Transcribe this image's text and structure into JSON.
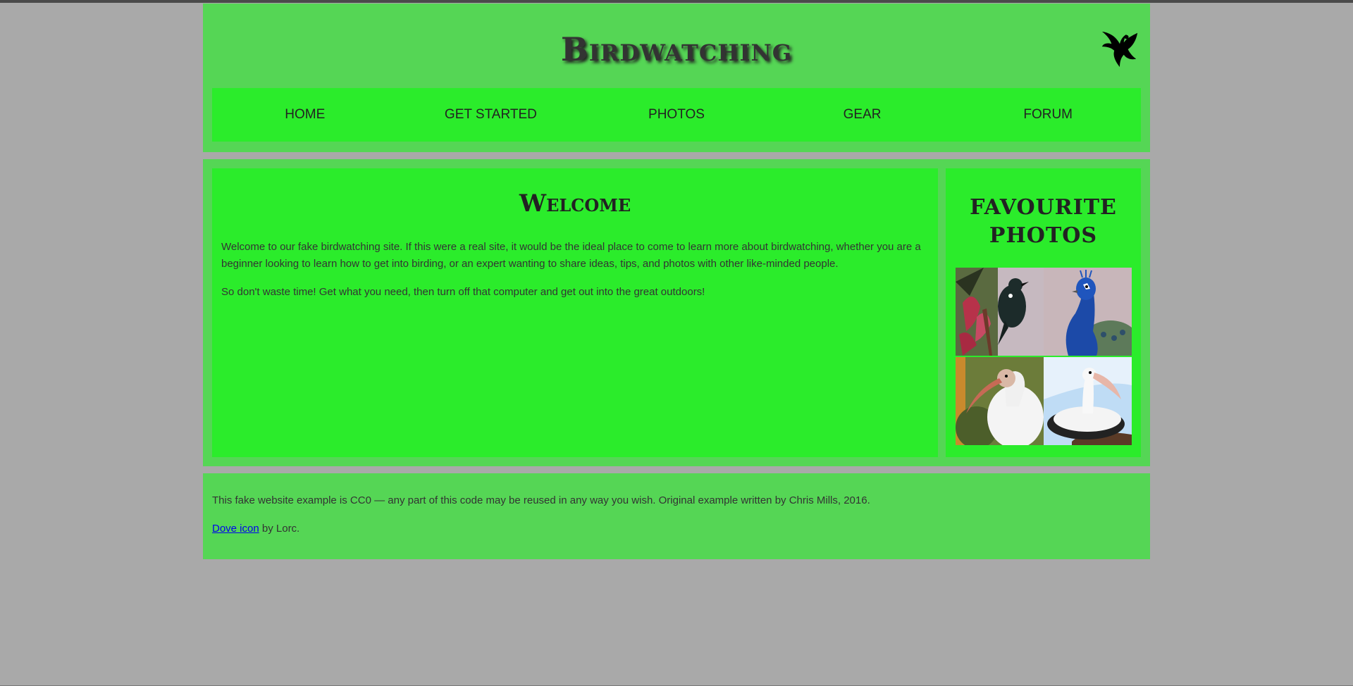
{
  "header": {
    "title": "Birdwatching",
    "logo_icon": "dove-icon"
  },
  "nav": {
    "items": [
      {
        "label": "HOME"
      },
      {
        "label": "GET STARTED"
      },
      {
        "label": "PHOTOS"
      },
      {
        "label": "GEAR"
      },
      {
        "label": "FORUM"
      }
    ]
  },
  "article": {
    "heading": "Welcome",
    "paragraphs": [
      "Welcome to our fake birdwatching site. If this were a real site, it would be the ideal place to come to learn more about birdwatching, whether you are a beginner looking to learn how to get into birding, or an expert wanting to share ideas, tips, and photos with other like-minded people.",
      "So don't waste time! Get what you need, then turn off that computer and get out into the great outdoors!"
    ]
  },
  "aside": {
    "heading": "FAVOURITE PHOTOS",
    "photos": [
      "tui-photo",
      "peacock-photo",
      "ibis-photo",
      "pelican-photo"
    ]
  },
  "footer": {
    "line1": "This fake website example is CC0 — any part of this code may be reused in any way you wish. Original example written by Chris Mills, 2016.",
    "link_text": "Dove icon",
    "line2_suffix": " by Lorc."
  },
  "colors": {
    "page_bg": "#a9a9a9",
    "panel_bg": "#55d655",
    "inner_bg": "#2bec2b"
  }
}
